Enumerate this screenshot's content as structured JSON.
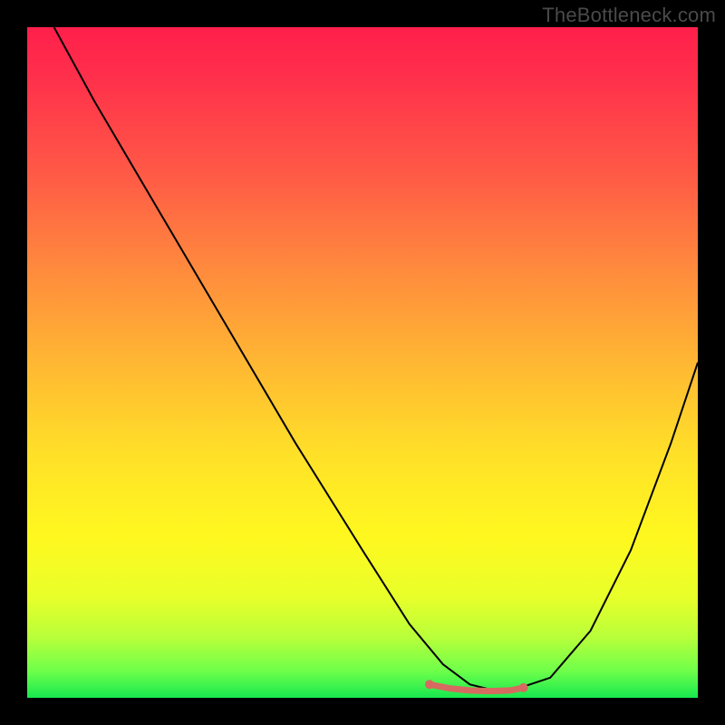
{
  "watermark": "TheBottleneck.com",
  "chart_data": {
    "type": "line",
    "title": "",
    "xlabel": "",
    "ylabel": "",
    "xlim": [
      0,
      100
    ],
    "ylim": [
      0,
      100
    ],
    "gradient_background": {
      "orientation": "vertical",
      "stops": [
        {
          "pos": 0.0,
          "color": "#ff1f4b"
        },
        {
          "pos": 0.5,
          "color": "#ffb733"
        },
        {
          "pos": 0.8,
          "color": "#fff81f"
        },
        {
          "pos": 1.0,
          "color": "#17e84f"
        }
      ]
    },
    "series": [
      {
        "name": "black-curve",
        "color": "#000000",
        "stroke_width": 2,
        "x": [
          4,
          10,
          20,
          30,
          40,
          50,
          57,
          62,
          66,
          70,
          72,
          78,
          84,
          90,
          96,
          100
        ],
        "values": [
          100,
          89,
          72,
          55,
          38,
          22,
          11,
          5,
          2,
          1,
          1,
          3,
          10,
          22,
          38,
          50
        ]
      },
      {
        "name": "red-trough-segment",
        "color": "#d66a60",
        "stroke_width": 7,
        "x": [
          60,
          63,
          66,
          69,
          72,
          74
        ],
        "values": [
          2.0,
          1.4,
          1.1,
          1.0,
          1.1,
          1.5
        ]
      }
    ],
    "markers": [
      {
        "name": "trough-endpoint-left",
        "x": 60,
        "y": 2.0,
        "r": 5,
        "color": "#d66a60"
      },
      {
        "name": "trough-endpoint-right",
        "x": 74,
        "y": 1.5,
        "r": 5,
        "color": "#d66a60"
      }
    ]
  }
}
